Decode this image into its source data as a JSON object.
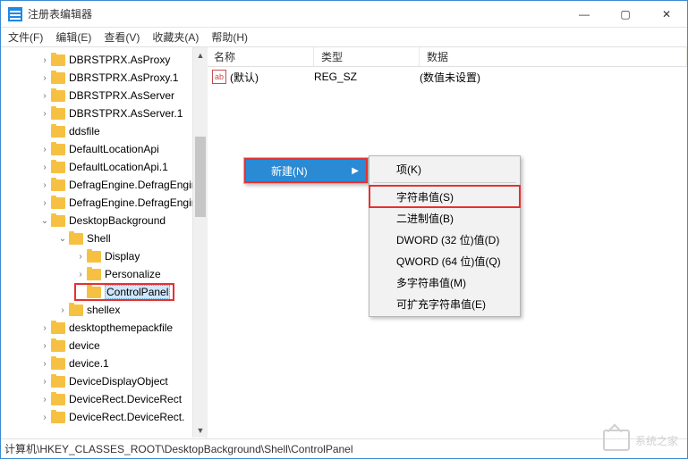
{
  "window": {
    "title": "注册表编辑器",
    "controls": {
      "min": "—",
      "max": "▢",
      "close": "✕"
    }
  },
  "menu": {
    "file": "文件(F)",
    "edit": "编辑(E)",
    "view": "查看(V)",
    "favorites": "收藏夹(A)",
    "help": "帮助(H)"
  },
  "tree": {
    "items": [
      {
        "indent": 44,
        "exp": "›",
        "label": "DBRSTPRX.AsProxy"
      },
      {
        "indent": 44,
        "exp": "›",
        "label": "DBRSTPRX.AsProxy.1"
      },
      {
        "indent": 44,
        "exp": "›",
        "label": "DBRSTPRX.AsServer"
      },
      {
        "indent": 44,
        "exp": "›",
        "label": "DBRSTPRX.AsServer.1"
      },
      {
        "indent": 44,
        "exp": "",
        "label": "ddsfile"
      },
      {
        "indent": 44,
        "exp": "›",
        "label": "DefaultLocationApi"
      },
      {
        "indent": 44,
        "exp": "›",
        "label": "DefaultLocationApi.1"
      },
      {
        "indent": 44,
        "exp": "›",
        "label": "DefragEngine.DefragEngine"
      },
      {
        "indent": 44,
        "exp": "›",
        "label": "DefragEngine.DefragEngine"
      },
      {
        "indent": 44,
        "exp": "⌄",
        "label": "DesktopBackground"
      },
      {
        "indent": 64,
        "exp": "⌄",
        "label": "Shell"
      },
      {
        "indent": 84,
        "exp": "›",
        "label": "Display"
      },
      {
        "indent": 84,
        "exp": "›",
        "label": "Personalize"
      },
      {
        "indent": 84,
        "exp": "",
        "label": "ControlPanel",
        "selected": true,
        "boxed": true
      },
      {
        "indent": 64,
        "exp": "›",
        "label": "shellex"
      },
      {
        "indent": 44,
        "exp": "›",
        "label": "desktopthemepackfile"
      },
      {
        "indent": 44,
        "exp": "›",
        "label": "device"
      },
      {
        "indent": 44,
        "exp": "›",
        "label": "device.1"
      },
      {
        "indent": 44,
        "exp": "›",
        "label": "DeviceDisplayObject"
      },
      {
        "indent": 44,
        "exp": "›",
        "label": "DeviceRect.DeviceRect"
      },
      {
        "indent": 44,
        "exp": "›",
        "label": "DeviceRect.DeviceRect."
      }
    ]
  },
  "list": {
    "headers": {
      "name": "名称",
      "type": "类型",
      "data": "数据"
    },
    "row": {
      "icon": "ab",
      "name": "(默认)",
      "type": "REG_SZ",
      "data": "(数值未设置)"
    }
  },
  "context": {
    "new": "新建(N)",
    "items": [
      "项(K)",
      "字符串值(S)",
      "二进制值(B)",
      "DWORD (32 位)值(D)",
      "QWORD (64 位)值(Q)",
      "多字符串值(M)",
      "可扩充字符串值(E)"
    ]
  },
  "statusbar": "计算机\\HKEY_CLASSES_ROOT\\DesktopBackground\\Shell\\ControlPanel",
  "watermark": "系统之家"
}
